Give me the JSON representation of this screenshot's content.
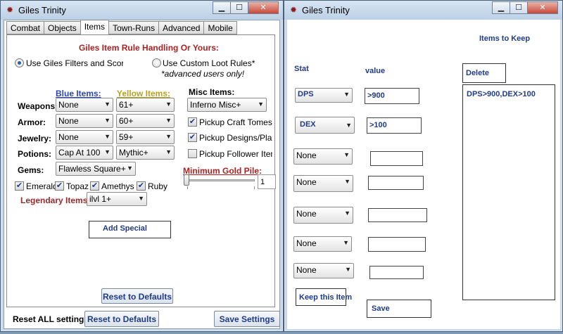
{
  "window1": {
    "title": "Giles Trinity",
    "tabs": [
      "Combat",
      "Objects",
      "Items",
      "Town-Runs",
      "Advanced",
      "Mobile"
    ],
    "active_tab": "Items",
    "heading": "Giles Item Rule Handling Or Yours:",
    "radio_giles": "Use Giles Filters and Scoring",
    "radio_custom": "Use Custom Loot Rules*",
    "advanced_note": "*advanced users only!",
    "blue_items_label": "Blue Items:",
    "yellow_items_label": "Yellow Items:",
    "misc_items_label": "Misc Items:",
    "rows": [
      {
        "label": "Weapons:",
        "blue": "None",
        "yellow": "61+"
      },
      {
        "label": "Armor:",
        "blue": "None",
        "yellow": "60+"
      },
      {
        "label": "Jewelry:",
        "blue": "None",
        "yellow": "59+"
      },
      {
        "label": "Potions:",
        "blue": "Cap At 100",
        "yellow": "Mythic+"
      }
    ],
    "misc_select": "Inferno Misc+",
    "pickup_craft": "Pickup Craft Tomes",
    "pickup_designs": "Pickup Designs/Plan",
    "pickup_follower": "Pickup Follower Item",
    "gems_label": "Gems:",
    "gems_select": "Flawless Square+",
    "min_gold_label": "Minimum Gold Pile:",
    "min_gold_value": "1",
    "gem_checks": [
      "Emerald",
      "Topaz",
      "Amethys",
      "Ruby"
    ],
    "legendary_label": "Legendary Items:",
    "legendary_select": "ilvl 1+",
    "add_special": "Add Special",
    "reset_defaults_inner": "Reset to Defaults",
    "reset_all_label": "Reset ALL settings:",
    "reset_defaults_bottom": "Reset to Defaults",
    "save_settings": "Save Settings"
  },
  "window2": {
    "title": "Giles Trinity",
    "items_to_keep": "Items to Keep",
    "stat_label": "Stat",
    "value_label": "value",
    "delete_label": "Delete",
    "rules": [
      {
        "stat": "DPS",
        "value": ">900"
      },
      {
        "stat": "DEX",
        "value": ">100"
      },
      {
        "stat": "None",
        "value": ""
      },
      {
        "stat": "None",
        "value": ""
      },
      {
        "stat": "None",
        "value": ""
      },
      {
        "stat": "None",
        "value": ""
      },
      {
        "stat": "None",
        "value": ""
      }
    ],
    "keep_list_item": "DPS>900,DEX>100",
    "keep_button": "Keep this Item",
    "save_button": "Save"
  },
  "colors": {
    "title_text": "#000000",
    "heading_red": "#b02020",
    "blue_label": "#2a45b5",
    "yellow_label": "#b9a21a",
    "button_text": "#1f3b8a"
  },
  "icons": {
    "app": "ladybug-icon",
    "minimize": "minimize-icon",
    "maximize": "maximize-icon",
    "close": "close-icon",
    "dropdown": "chevron-down-icon",
    "check": "check-icon"
  }
}
